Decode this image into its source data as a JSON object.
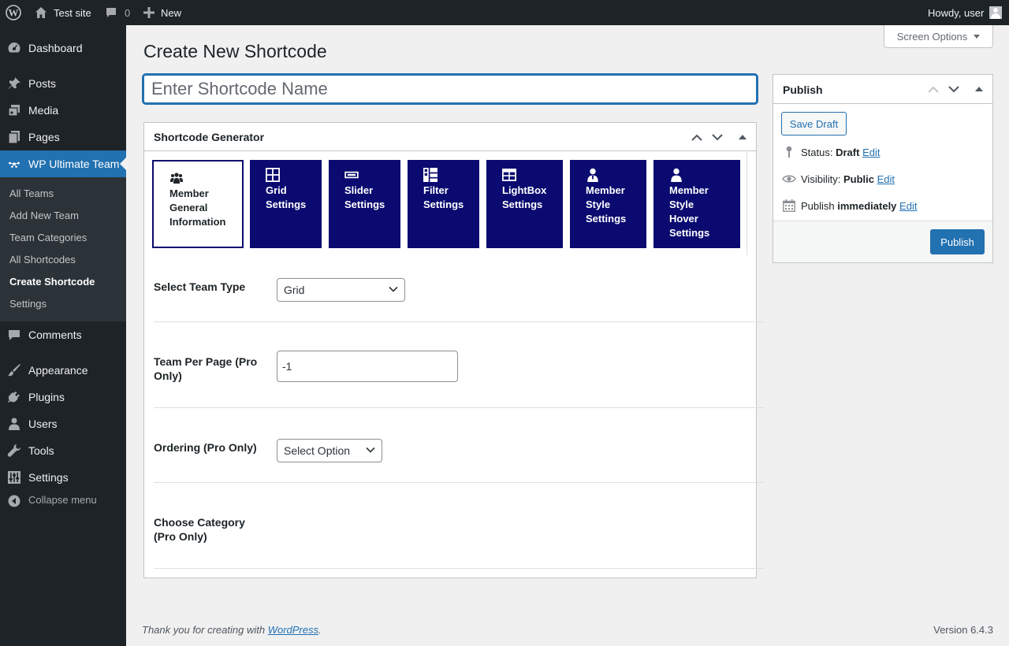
{
  "admin_bar": {
    "site_name": "Test site",
    "comments_count": "0",
    "new_label": "New",
    "greeting": "Howdy, user"
  },
  "sidebar": {
    "items": [
      {
        "label": "Dashboard",
        "icon": "dashboard-icon"
      },
      {
        "label": "Posts",
        "icon": "pushpin-icon"
      },
      {
        "label": "Media",
        "icon": "media-icon"
      },
      {
        "label": "Pages",
        "icon": "pages-icon"
      },
      {
        "label": "WP Ultimate Team",
        "icon": "team-icon"
      },
      {
        "label": "Comments",
        "icon": "comment-icon"
      },
      {
        "label": "Appearance",
        "icon": "brush-icon"
      },
      {
        "label": "Plugins",
        "icon": "plug-icon"
      },
      {
        "label": "Users",
        "icon": "user-icon"
      },
      {
        "label": "Tools",
        "icon": "wrench-icon"
      },
      {
        "label": "Settings",
        "icon": "sliders-icon"
      }
    ],
    "submenu": [
      "All Teams",
      "Add New Team",
      "Team Categories",
      "All Shortcodes",
      "Create Shortcode",
      "Settings"
    ],
    "collapse_label": "Collapse menu"
  },
  "screen_options_label": "Screen Options",
  "page_title": "Create New Shortcode",
  "title_placeholder": "Enter Shortcode Name",
  "generator": {
    "title": "Shortcode Generator",
    "tabs": [
      {
        "label": "Member General Information",
        "icon": "group-icon"
      },
      {
        "label": "Grid Settings",
        "icon": "grid-icon"
      },
      {
        "label": "Slider Settings",
        "icon": "slider-icon"
      },
      {
        "label": "Filter Settings",
        "icon": "filter-layout-icon"
      },
      {
        "label": "LightBox Settings",
        "icon": "table-icon"
      },
      {
        "label": "Member Style Settings",
        "icon": "member-icon"
      },
      {
        "label": "Member Style Hover Settings",
        "icon": "member-hover-icon"
      }
    ],
    "fields": {
      "team_type_label": "Select Team Type",
      "team_type_value": "Grid",
      "per_page_label": "Team Per Page (Pro Only)",
      "per_page_value": "-1",
      "ordering_label": "Ordering (Pro Only)",
      "ordering_value": "Select Option",
      "category_label": "Choose Category (Pro Only)"
    }
  },
  "publish": {
    "title": "Publish",
    "save_draft": "Save Draft",
    "status_label": "Status:",
    "status_value": "Draft",
    "visibility_label": "Visibility:",
    "visibility_value": "Public",
    "schedule_label": "Publish",
    "schedule_value": "immediately",
    "edit_label": "Edit",
    "publish_button": "Publish"
  },
  "footer": {
    "thanks_prefix": "Thank you for creating with ",
    "wordpress_link": "WordPress",
    "thanks_suffix": ".",
    "version": "Version 6.4.3"
  },
  "colors": {
    "admin_dark": "#1d2327",
    "accent": "#2271b1",
    "tab_bg": "#0a0a70"
  }
}
